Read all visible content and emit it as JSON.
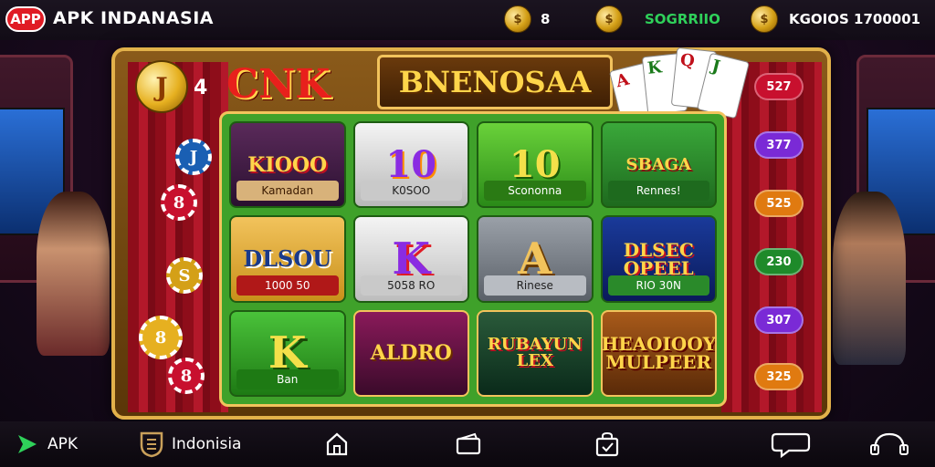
{
  "header": {
    "badge": "APP",
    "title": "APK INDANASIA",
    "coin1_value": "8",
    "stat2": "SOGRRIIO",
    "stat3": "KGOIOS 1700001"
  },
  "frame": {
    "title": "BNENOSAA",
    "logo": "CNK",
    "big_coin": "J",
    "chip_labels": [
      "J",
      "8",
      "S",
      "8",
      "8"
    ]
  },
  "tiles": [
    {
      "big": "KIOOO",
      "caption": "Kamadan"
    },
    {
      "big": "10",
      "caption": "K0SOO"
    },
    {
      "big": "10",
      "caption": "Scononna"
    },
    {
      "big": "SBAGA",
      "caption": "Rennes!"
    },
    {
      "big": "DLSOU",
      "caption": "1000 50"
    },
    {
      "big": "K",
      "caption": "5058 RO"
    },
    {
      "big": "A",
      "caption": "Rinese"
    },
    {
      "big": "DLSEC OPEEL",
      "caption": "RIO 30N"
    },
    {
      "big": "K",
      "caption": "Ban"
    },
    {
      "big": "ALDRO",
      "caption": ""
    },
    {
      "big": "RUBAYUN LEX",
      "caption": ""
    },
    {
      "big": "HEAOIOOY MULPEER",
      "caption": ""
    }
  ],
  "side_pills": [
    "527",
    "377",
    "525",
    "230",
    "307",
    "325"
  ],
  "bottom_nav": {
    "apk_label": "APK",
    "indonesia_label": "Indonisia"
  },
  "colors": {
    "brand_red": "#e01b24",
    "gold": "#f2c35c",
    "felt_green": "#3fa12a",
    "stat_green": "#2fd15a"
  }
}
